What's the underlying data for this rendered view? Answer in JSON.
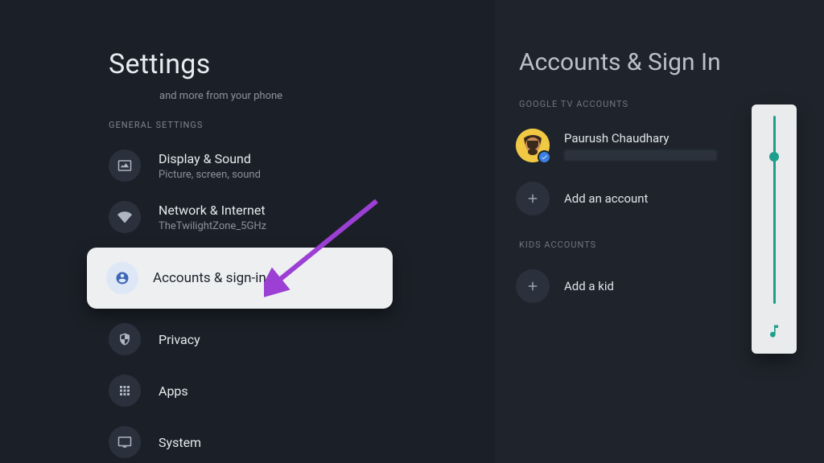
{
  "left": {
    "title": "Settings",
    "subtext": "and more from your phone",
    "section_label": "GENERAL SETTINGS",
    "items": [
      {
        "primary": "Display & Sound",
        "secondary": "Picture, screen, sound"
      },
      {
        "primary": "Network & Internet",
        "secondary": "TheTwilightZone_5GHz"
      },
      {
        "primary": "Accounts & sign-in"
      },
      {
        "primary": "Privacy"
      },
      {
        "primary": "Apps"
      },
      {
        "primary": "System"
      }
    ]
  },
  "right": {
    "title": "Accounts & Sign In",
    "google_section": "GOOGLE TV ACCOUNTS",
    "account_name": "Paurush Chaudhary",
    "add_account": "Add an account",
    "kids_section": "KIDS ACCOUNTS",
    "add_kid": "Add a kid"
  },
  "volume": {
    "percent": 78
  },
  "colors": {
    "accent": "#1f9e8c",
    "arrow": "#9c3fd4"
  }
}
